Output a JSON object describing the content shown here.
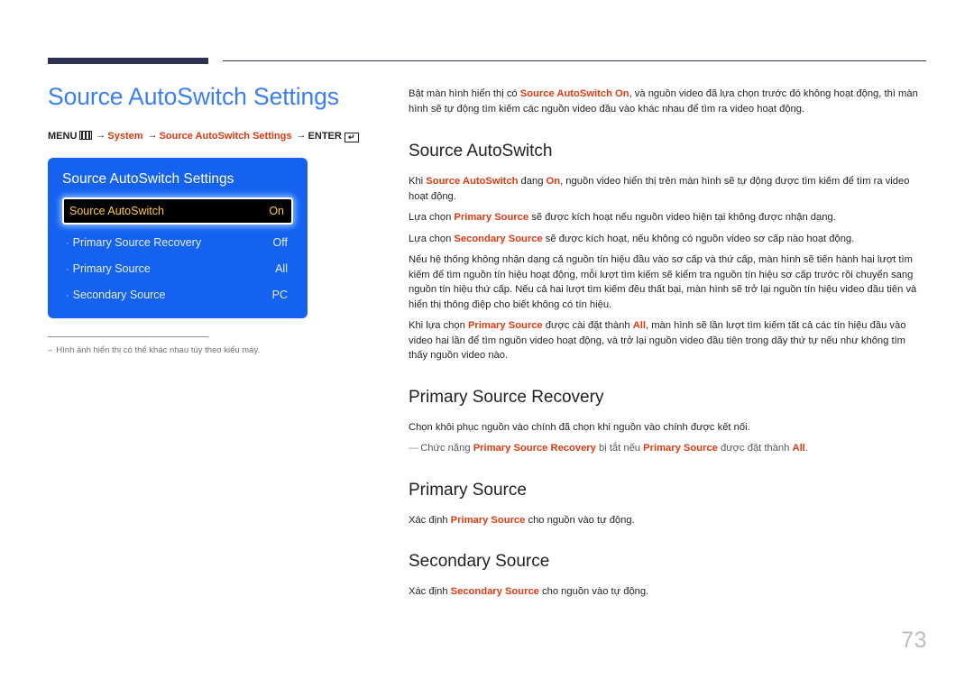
{
  "page": {
    "number": "73",
    "title": "Source AutoSwitch Settings"
  },
  "menu_path": {
    "menu_label": "MENU",
    "menu_icon": "menu-bars-icon",
    "arrow": "→",
    "item1": "System",
    "item2": "Source AutoSwitch Settings",
    "enter_label": "ENTER",
    "enter_icon": "↵"
  },
  "osd": {
    "title": "Source AutoSwitch Settings",
    "rows": [
      {
        "bullet": "",
        "label": "Source AutoSwitch",
        "value": "On",
        "selected": true
      },
      {
        "bullet": "·",
        "label": "Primary Source Recovery",
        "value": "Off",
        "selected": false
      },
      {
        "bullet": "·",
        "label": "Primary Source",
        "value": "All",
        "selected": false
      },
      {
        "bullet": "·",
        "label": "Secondary Source",
        "value": "PC",
        "selected": false
      }
    ]
  },
  "footnote": {
    "dash": "–",
    "text": "Hình ảnh hiển thị có thể khác nhau tùy theo kiểu máy."
  },
  "content": {
    "intro": {
      "p1_a": "Bật màn hình hiển thị có ",
      "p1_hl": "Source AutoSwitch On",
      "p1_b": ", và nguồn video đã lựa chọn trước đó không hoạt động, thì màn hình sẽ tự động tìm kiếm các nguồn video đầu vào khác nhau để tìm ra video hoạt động."
    },
    "s1": {
      "heading": "Source AutoSwitch",
      "p1_a": "Khi ",
      "p1_hl1": "Source AutoSwitch",
      "p1_b": " đang ",
      "p1_hl2": "On",
      "p1_c": ", nguồn video hiển thị trên màn hình sẽ tự động được tìm kiếm để tìm ra video hoạt động.",
      "p2_a": "Lựa chọn ",
      "p2_hl": "Primary Source",
      "p2_b": " sẽ được kích hoạt nếu nguồn video hiện tại không được nhận dạng.",
      "p3_a": "Lựa chọn ",
      "p3_hl": "Secondary Source",
      "p3_b": " sẽ được kích hoạt, nếu không có nguồn video sơ cấp nào hoạt động.",
      "p4": "Nếu hệ thống không nhận dạng cả nguồn tín hiệu đầu vào sơ cấp và thứ cấp, màn hình sẽ tiến hành hai lượt tìm kiếm để tìm nguồn tín hiệu hoạt động, mỗi lượt tìm kiếm sẽ kiểm tra nguồn tín hiệu sơ cấp trước rồi chuyển sang nguồn tín hiệu thứ cấp. Nếu cả hai lượt tìm kiếm đều thất bại, màn hình sẽ trở lại nguồn tín hiệu video đầu tiên và hiển thị thông điệp cho biết không có tín hiệu.",
      "p5_a": "Khi lựa chọn ",
      "p5_hl1": "Primary Source",
      "p5_b": " được cài đặt thành ",
      "p5_hl2": "All",
      "p5_c": ", màn hình sẽ lần lượt tìm kiếm tất cả các tín hiệu đầu vào video hai lần để tìm nguồn video hoạt động, và trở lại nguồn video đầu tiên trong dãy thứ tự nếu như không tìm thấy nguồn video nào."
    },
    "s2": {
      "heading": "Primary Source Recovery",
      "p1": "Chọn khôi phục nguồn vào chính đã chọn khi nguồn vào chính được kết nối.",
      "note_dash": "—",
      "note_a": "Chức năng ",
      "note_hl1": "Primary Source Recovery",
      "note_b": " bị tắt nếu ",
      "note_hl2": "Primary Source",
      "note_c": " được đặt thành ",
      "note_hl3": "All",
      "note_d": "."
    },
    "s3": {
      "heading": "Primary Source",
      "p1_a": "Xác định ",
      "p1_hl": "Primary Source",
      "p1_b": " cho nguồn vào tự động."
    },
    "s4": {
      "heading": "Secondary Source",
      "p1_a": "Xác định ",
      "p1_hl": "Secondary Source",
      "p1_b": " cho nguồn vào tự động."
    }
  },
  "colors": {
    "title_blue": "#3b7ef4",
    "accent_red": "#e03a12",
    "rule_navy": "#2e3152",
    "osd_blue": "#1562f0",
    "osd_selected_text": "#ffcc33",
    "page_number": "#b9bcc2"
  }
}
